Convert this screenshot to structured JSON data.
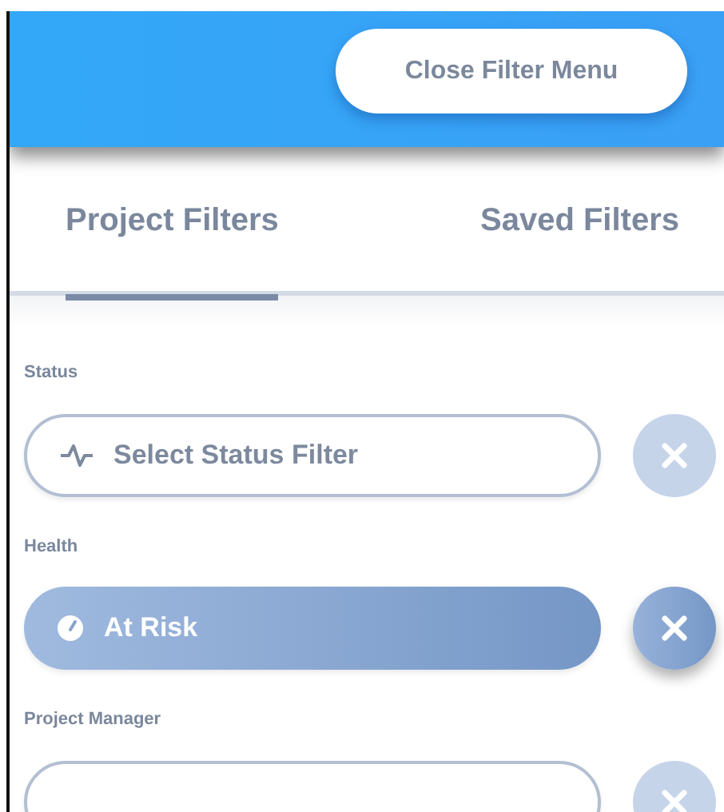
{
  "header": {
    "close_button": "Close Filter Menu"
  },
  "tabs": [
    {
      "label": "Project Filters",
      "selected": true
    },
    {
      "label": "Saved Filters",
      "selected": false
    }
  ],
  "filters": [
    {
      "label": "Status",
      "placeholder": "Select Status Filter",
      "kind": "pulse",
      "set": false
    },
    {
      "label": "Health",
      "value": "At Risk",
      "kind": "gauge",
      "set": true
    },
    {
      "label": "Project Manager",
      "set": false
    }
  ]
}
